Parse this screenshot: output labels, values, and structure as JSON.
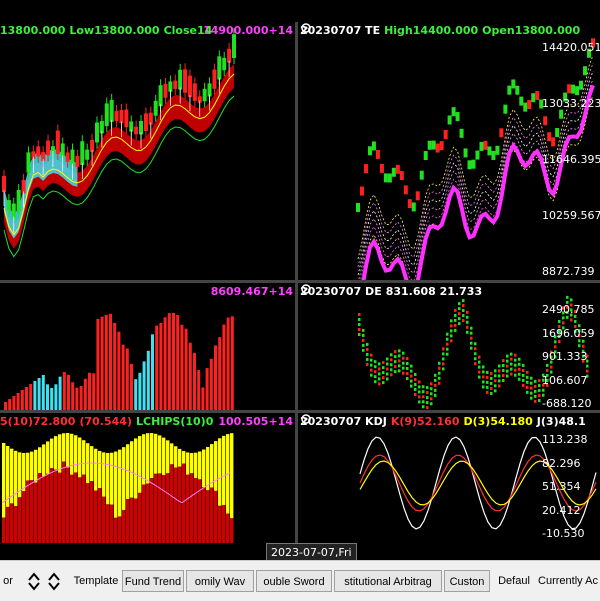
{
  "panes": {
    "top_left": {
      "header": [
        {
          "text": "13800.000",
          "color": "#3cf03c"
        },
        {
          "text": "Low13800.000",
          "color": "#3cf03c"
        },
        {
          "text": "Close14",
          "color": "#3cf03c"
        }
      ],
      "right_label": "14900.000+14"
    },
    "top_right": {
      "date": "20230707 TE",
      "items": [
        {
          "text": "High14400.000",
          "color": "#3cf03c"
        },
        {
          "text": "Open13800.000",
          "color": "#3cf03c"
        }
      ],
      "ticks": [
        "14420.051",
        "13033.223",
        "11646.395",
        "10259.567",
        "8872.739"
      ]
    },
    "mid_left": {
      "right_label": "8609.467+14"
    },
    "mid_right": {
      "date": "20230707 DE",
      "items": [
        {
          "text": "831.608 21.733",
          "color": "#ffffff"
        }
      ],
      "ticks": [
        "2490.785",
        "1696.059",
        "901.333",
        "106.607",
        "-688.120"
      ]
    },
    "bot_left": {
      "header": [
        {
          "text": "5(10)72.800",
          "color": "#ff3030"
        },
        {
          "text": "(70.544)",
          "color": "#ff3030"
        },
        {
          "text": "LCHIPS(10)0",
          "color": "#3cf03c"
        }
      ],
      "right_label": "100.505+14"
    },
    "bot_right": {
      "date": "20230707 KDJ",
      "items": [
        {
          "text": "K(9)52.160",
          "color": "#ff3030"
        },
        {
          "text": "D(3)54.180",
          "color": "#ffff00"
        },
        {
          "text": "J(3)48.1",
          "color": "#ffffff"
        }
      ],
      "ticks": [
        "113.238",
        "82.296",
        "51.354",
        "20.412",
        "-10.530"
      ]
    }
  },
  "date_badge": "2023-07-07,Fri",
  "tabs": [
    {
      "label": "or",
      "kind": "plain"
    },
    {
      "label": "Template",
      "kind": "plain"
    },
    {
      "label": "Fund Trend",
      "kind": "tab"
    },
    {
      "label": "omily Wav",
      "kind": "tab"
    },
    {
      "label": "ouble Sword",
      "kind": "tab"
    },
    {
      "label": "stitutional Arbitrag",
      "kind": "tab"
    },
    {
      "label": "Custon",
      "kind": "tab"
    },
    {
      "label": "Defaul",
      "kind": "plain"
    },
    {
      "label": "Currently Ac",
      "kind": "plain"
    }
  ],
  "colors": {
    "up": "#ff2020",
    "down": "#20e020",
    "cyan": "#40e0f0",
    "magenta": "#ff30ff",
    "yellow": "#ffff00",
    "bg": "#000000"
  },
  "icons": [
    "gear-icon",
    "arrow-up-down-icon"
  ]
}
